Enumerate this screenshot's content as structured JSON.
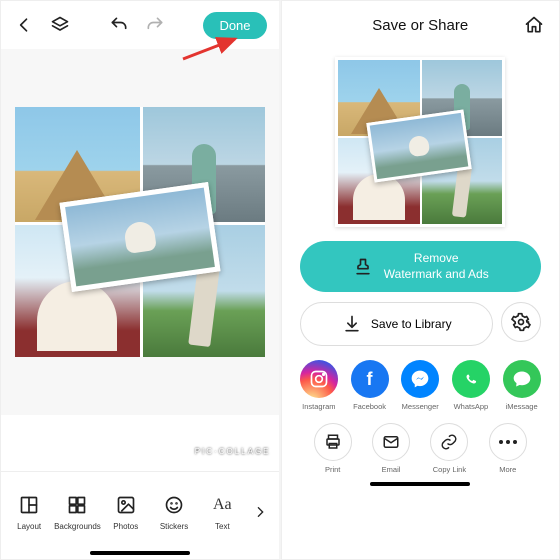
{
  "left": {
    "done_label": "Done",
    "watermark": "PIC·COLLAGE",
    "tools": [
      {
        "icon": "layout-icon",
        "label": "Layout"
      },
      {
        "icon": "backgrounds-icon",
        "label": "Backgrounds"
      },
      {
        "icon": "photos-icon",
        "label": "Photos"
      },
      {
        "icon": "stickers-icon",
        "label": "Stickers"
      },
      {
        "icon": "text-icon",
        "label": "Text"
      }
    ]
  },
  "right": {
    "title": "Save or Share",
    "remove_btn": "Remove\nWatermark and Ads",
    "save_btn": "Save to Library",
    "share": [
      {
        "id": "instagram",
        "label": "Instagram"
      },
      {
        "id": "facebook",
        "label": "Facebook"
      },
      {
        "id": "messenger",
        "label": "Messenger"
      },
      {
        "id": "whatsapp",
        "label": "WhatsApp"
      },
      {
        "id": "imessage",
        "label": "iMessage"
      }
    ],
    "actions": [
      {
        "id": "print",
        "label": "Print"
      },
      {
        "id": "email",
        "label": "Email"
      },
      {
        "id": "copylink",
        "label": "Copy Link"
      },
      {
        "id": "more",
        "label": "More"
      }
    ]
  },
  "colors": {
    "accent": "#29c0b8"
  }
}
